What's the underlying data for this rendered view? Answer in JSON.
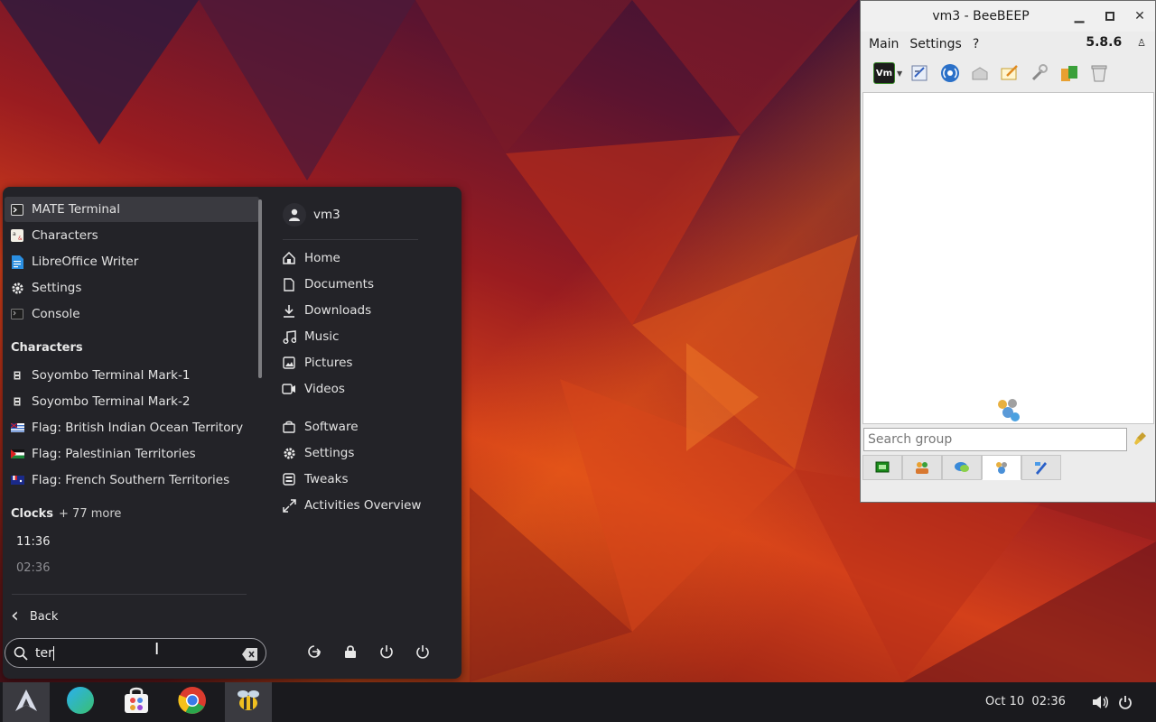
{
  "menu": {
    "results": [
      {
        "label": "MATE Terminal",
        "icon": "terminal-icon",
        "selected": true
      },
      {
        "label": "Characters",
        "icon": "characters-icon"
      },
      {
        "label": "LibreOffice Writer",
        "icon": "writer-icon"
      },
      {
        "label": "Settings",
        "icon": "gear-icon"
      },
      {
        "label": "Console",
        "icon": "console-icon"
      }
    ],
    "characters_heading": "Characters",
    "characters": [
      {
        "label": "Soyombo Terminal Mark-1"
      },
      {
        "label": "Soyombo Terminal Mark-2"
      },
      {
        "label": "Flag: British Indian Ocean Territory"
      },
      {
        "label": "Flag: Palestinian Territories"
      },
      {
        "label": "Flag: French Southern Territories"
      }
    ],
    "clocks_heading": "Clocks",
    "clocks_more": "+ 77 more",
    "clocks": [
      "11:36",
      "02:36"
    ],
    "back_label": "Back",
    "search_value": "ter",
    "user_name": "vm3",
    "places": [
      "Home",
      "Documents",
      "Downloads",
      "Music",
      "Pictures",
      "Videos"
    ],
    "apps": [
      "Software",
      "Settings",
      "Tweaks",
      "Activities Overview"
    ]
  },
  "beebeep": {
    "title": "vm3 - BeeBEEP",
    "menu": [
      "Main",
      "Settings",
      "?"
    ],
    "version": "5.8.6",
    "search_placeholder": "Search group"
  },
  "taskbar": {
    "date": "Oct 10",
    "time": "02:36"
  },
  "colors": {
    "menu_bg": "#232328",
    "selected_row": "#3a3a40",
    "taskbar_bg": "#1a1a1e"
  }
}
